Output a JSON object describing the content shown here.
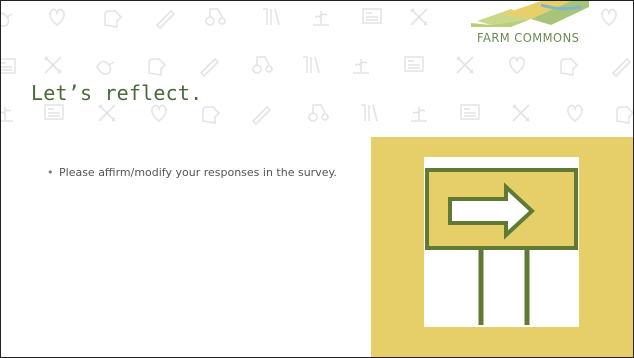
{
  "slide": {
    "title": "Let’s reflect.",
    "logo": {
      "text": "FARM COMMONS"
    },
    "body": {
      "bullets": [
        "Please affirm/modify your responses in the survey."
      ]
    },
    "image": {
      "icon": "directional-sign-arrow-right-icon"
    }
  },
  "colors": {
    "title": "#4a6a3a",
    "panel": "#e6cf68",
    "sign_stroke": "#5e7a35",
    "pattern": "#e4e4e4"
  }
}
